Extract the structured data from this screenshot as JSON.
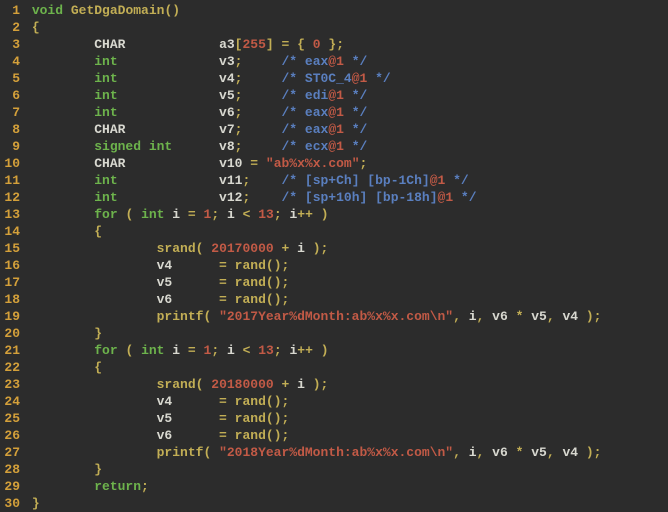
{
  "lines": [
    {
      "n": "1",
      "indent": " ",
      "tokens": [
        [
          "kw",
          "void"
        ],
        [
          "plain",
          " "
        ],
        [
          "func",
          "GetDgaDomain"
        ],
        [
          "punct",
          "()"
        ]
      ]
    },
    {
      "n": "2",
      "indent": " ",
      "tokens": [
        [
          "punct",
          "{"
        ]
      ]
    },
    {
      "n": "3",
      "indent": "         ",
      "tokens": [
        [
          "type",
          "CHAR"
        ],
        [
          "plain",
          "            "
        ],
        [
          "ident",
          "a3"
        ],
        [
          "punct",
          "["
        ],
        [
          "num",
          "255"
        ],
        [
          "punct",
          "]"
        ],
        [
          "plain",
          " "
        ],
        [
          "punct",
          "="
        ],
        [
          "plain",
          " "
        ],
        [
          "punct",
          "{"
        ],
        [
          "plain",
          " "
        ],
        [
          "num",
          "0"
        ],
        [
          "plain",
          " "
        ],
        [
          "punct",
          "};"
        ]
      ]
    },
    {
      "n": "4",
      "indent": "         ",
      "tokens": [
        [
          "kw",
          "int"
        ],
        [
          "plain",
          "             "
        ],
        [
          "ident",
          "v3"
        ],
        [
          "punct",
          ";"
        ],
        [
          "plain",
          "     "
        ],
        [
          "cmt",
          "/* eax"
        ],
        [
          "at",
          "@1"
        ],
        [
          "cmt",
          " */"
        ]
      ]
    },
    {
      "n": "5",
      "indent": "         ",
      "tokens": [
        [
          "kw",
          "int"
        ],
        [
          "plain",
          "             "
        ],
        [
          "ident",
          "v4"
        ],
        [
          "punct",
          ";"
        ],
        [
          "plain",
          "     "
        ],
        [
          "cmt",
          "/* ST0C_4"
        ],
        [
          "at",
          "@1"
        ],
        [
          "cmt",
          " */"
        ]
      ]
    },
    {
      "n": "6",
      "indent": "         ",
      "tokens": [
        [
          "kw",
          "int"
        ],
        [
          "plain",
          "             "
        ],
        [
          "ident",
          "v5"
        ],
        [
          "punct",
          ";"
        ],
        [
          "plain",
          "     "
        ],
        [
          "cmt",
          "/* edi"
        ],
        [
          "at",
          "@1"
        ],
        [
          "cmt",
          " */"
        ]
      ]
    },
    {
      "n": "7",
      "indent": "         ",
      "tokens": [
        [
          "kw",
          "int"
        ],
        [
          "plain",
          "             "
        ],
        [
          "ident",
          "v6"
        ],
        [
          "punct",
          ";"
        ],
        [
          "plain",
          "     "
        ],
        [
          "cmt",
          "/* eax"
        ],
        [
          "at",
          "@1"
        ],
        [
          "cmt",
          " */"
        ]
      ]
    },
    {
      "n": "8",
      "indent": "         ",
      "tokens": [
        [
          "type",
          "CHAR"
        ],
        [
          "plain",
          "            "
        ],
        [
          "ident",
          "v7"
        ],
        [
          "punct",
          ";"
        ],
        [
          "plain",
          "     "
        ],
        [
          "cmt",
          "/* eax"
        ],
        [
          "at",
          "@1"
        ],
        [
          "cmt",
          " */"
        ]
      ]
    },
    {
      "n": "9",
      "indent": "         ",
      "tokens": [
        [
          "kw",
          "signed int"
        ],
        [
          "plain",
          "      "
        ],
        [
          "ident",
          "v8"
        ],
        [
          "punct",
          ";"
        ],
        [
          "plain",
          "     "
        ],
        [
          "cmt",
          "/* ecx"
        ],
        [
          "at",
          "@1"
        ],
        [
          "cmt",
          " */"
        ]
      ]
    },
    {
      "n": "10",
      "indent": "         ",
      "tokens": [
        [
          "type",
          "CHAR"
        ],
        [
          "plain",
          "            "
        ],
        [
          "ident",
          "v10"
        ],
        [
          "plain",
          " "
        ],
        [
          "punct",
          "="
        ],
        [
          "plain",
          " "
        ],
        [
          "str",
          "\"ab%x%x.com\""
        ],
        [
          "punct",
          ";"
        ]
      ]
    },
    {
      "n": "11",
      "indent": "         ",
      "tokens": [
        [
          "kw",
          "int"
        ],
        [
          "plain",
          "             "
        ],
        [
          "ident",
          "v11"
        ],
        [
          "punct",
          ";"
        ],
        [
          "plain",
          "    "
        ],
        [
          "cmt",
          "/* [sp+Ch] [bp-1Ch]"
        ],
        [
          "at",
          "@1"
        ],
        [
          "cmt",
          " */"
        ]
      ]
    },
    {
      "n": "12",
      "indent": "         ",
      "tokens": [
        [
          "kw",
          "int"
        ],
        [
          "plain",
          "             "
        ],
        [
          "ident",
          "v12"
        ],
        [
          "punct",
          ";"
        ],
        [
          "plain",
          "    "
        ],
        [
          "cmt",
          "/* [sp+10h] [bp-18h]"
        ],
        [
          "at",
          "@1"
        ],
        [
          "cmt",
          " */"
        ]
      ]
    },
    {
      "n": "13",
      "indent": "         ",
      "tokens": [
        [
          "kw",
          "for"
        ],
        [
          "plain",
          " "
        ],
        [
          "punct",
          "("
        ],
        [
          "plain",
          " "
        ],
        [
          "kw",
          "int"
        ],
        [
          "plain",
          " "
        ],
        [
          "ident",
          "i"
        ],
        [
          "plain",
          " "
        ],
        [
          "punct",
          "="
        ],
        [
          "plain",
          " "
        ],
        [
          "num",
          "1"
        ],
        [
          "punct",
          ";"
        ],
        [
          "plain",
          " "
        ],
        [
          "ident",
          "i"
        ],
        [
          "plain",
          " "
        ],
        [
          "punct",
          "<"
        ],
        [
          "plain",
          " "
        ],
        [
          "num",
          "13"
        ],
        [
          "punct",
          ";"
        ],
        [
          "plain",
          " "
        ],
        [
          "ident",
          "i"
        ],
        [
          "punct",
          "++"
        ],
        [
          "plain",
          " "
        ],
        [
          "punct",
          ")"
        ]
      ]
    },
    {
      "n": "14",
      "indent": "         ",
      "tokens": [
        [
          "punct",
          "{"
        ]
      ]
    },
    {
      "n": "15",
      "indent": "                 ",
      "tokens": [
        [
          "func",
          "srand"
        ],
        [
          "punct",
          "("
        ],
        [
          "plain",
          " "
        ],
        [
          "num",
          "20170000"
        ],
        [
          "plain",
          " "
        ],
        [
          "punct",
          "+"
        ],
        [
          "plain",
          " "
        ],
        [
          "ident",
          "i"
        ],
        [
          "plain",
          " "
        ],
        [
          "punct",
          ");"
        ]
      ]
    },
    {
      "n": "16",
      "indent": "                 ",
      "tokens": [
        [
          "ident",
          "v4"
        ],
        [
          "plain",
          "      "
        ],
        [
          "punct",
          "="
        ],
        [
          "plain",
          " "
        ],
        [
          "func",
          "rand"
        ],
        [
          "punct",
          "();"
        ]
      ]
    },
    {
      "n": "17",
      "indent": "                 ",
      "tokens": [
        [
          "ident",
          "v5"
        ],
        [
          "plain",
          "      "
        ],
        [
          "punct",
          "="
        ],
        [
          "plain",
          " "
        ],
        [
          "func",
          "rand"
        ],
        [
          "punct",
          "();"
        ]
      ]
    },
    {
      "n": "18",
      "indent": "                 ",
      "tokens": [
        [
          "ident",
          "v6"
        ],
        [
          "plain",
          "      "
        ],
        [
          "punct",
          "="
        ],
        [
          "plain",
          " "
        ],
        [
          "func",
          "rand"
        ],
        [
          "punct",
          "();"
        ]
      ]
    },
    {
      "n": "19",
      "indent": "                 ",
      "tokens": [
        [
          "func",
          "printf"
        ],
        [
          "punct",
          "("
        ],
        [
          "plain",
          " "
        ],
        [
          "str",
          "\"2017Year%dMonth:ab%x%x.com\\n\""
        ],
        [
          "punct",
          ","
        ],
        [
          "plain",
          " "
        ],
        [
          "ident",
          "i"
        ],
        [
          "punct",
          ","
        ],
        [
          "plain",
          " "
        ],
        [
          "ident",
          "v6"
        ],
        [
          "plain",
          " "
        ],
        [
          "punct",
          "*"
        ],
        [
          "plain",
          " "
        ],
        [
          "ident",
          "v5"
        ],
        [
          "punct",
          ","
        ],
        [
          "plain",
          " "
        ],
        [
          "ident",
          "v4"
        ],
        [
          "plain",
          " "
        ],
        [
          "punct",
          ");"
        ]
      ]
    },
    {
      "n": "20",
      "indent": "         ",
      "tokens": [
        [
          "punct",
          "}"
        ]
      ]
    },
    {
      "n": "21",
      "indent": "         ",
      "tokens": [
        [
          "kw",
          "for"
        ],
        [
          "plain",
          " "
        ],
        [
          "punct",
          "("
        ],
        [
          "plain",
          " "
        ],
        [
          "kw",
          "int"
        ],
        [
          "plain",
          " "
        ],
        [
          "ident",
          "i"
        ],
        [
          "plain",
          " "
        ],
        [
          "punct",
          "="
        ],
        [
          "plain",
          " "
        ],
        [
          "num",
          "1"
        ],
        [
          "punct",
          ";"
        ],
        [
          "plain",
          " "
        ],
        [
          "ident",
          "i"
        ],
        [
          "plain",
          " "
        ],
        [
          "punct",
          "<"
        ],
        [
          "plain",
          " "
        ],
        [
          "num",
          "13"
        ],
        [
          "punct",
          ";"
        ],
        [
          "plain",
          " "
        ],
        [
          "ident",
          "i"
        ],
        [
          "punct",
          "++"
        ],
        [
          "plain",
          " "
        ],
        [
          "punct",
          ")"
        ]
      ]
    },
    {
      "n": "22",
      "indent": "         ",
      "tokens": [
        [
          "punct",
          "{"
        ]
      ]
    },
    {
      "n": "23",
      "indent": "                 ",
      "tokens": [
        [
          "func",
          "srand"
        ],
        [
          "punct",
          "("
        ],
        [
          "plain",
          " "
        ],
        [
          "num",
          "20180000"
        ],
        [
          "plain",
          " "
        ],
        [
          "punct",
          "+"
        ],
        [
          "plain",
          " "
        ],
        [
          "ident",
          "i"
        ],
        [
          "plain",
          " "
        ],
        [
          "punct",
          ");"
        ]
      ]
    },
    {
      "n": "24",
      "indent": "                 ",
      "tokens": [
        [
          "ident",
          "v4"
        ],
        [
          "plain",
          "      "
        ],
        [
          "punct",
          "="
        ],
        [
          "plain",
          " "
        ],
        [
          "func",
          "rand"
        ],
        [
          "punct",
          "();"
        ]
      ]
    },
    {
      "n": "25",
      "indent": "                 ",
      "tokens": [
        [
          "ident",
          "v5"
        ],
        [
          "plain",
          "      "
        ],
        [
          "punct",
          "="
        ],
        [
          "plain",
          " "
        ],
        [
          "func",
          "rand"
        ],
        [
          "punct",
          "();"
        ]
      ]
    },
    {
      "n": "26",
      "indent": "                 ",
      "tokens": [
        [
          "ident",
          "v6"
        ],
        [
          "plain",
          "      "
        ],
        [
          "punct",
          "="
        ],
        [
          "plain",
          " "
        ],
        [
          "func",
          "rand"
        ],
        [
          "punct",
          "();"
        ]
      ]
    },
    {
      "n": "27",
      "indent": "                 ",
      "tokens": [
        [
          "func",
          "printf"
        ],
        [
          "punct",
          "("
        ],
        [
          "plain",
          " "
        ],
        [
          "str",
          "\"2018Year%dMonth:ab%x%x.com\\n\""
        ],
        [
          "punct",
          ","
        ],
        [
          "plain",
          " "
        ],
        [
          "ident",
          "i"
        ],
        [
          "punct",
          ","
        ],
        [
          "plain",
          " "
        ],
        [
          "ident",
          "v6"
        ],
        [
          "plain",
          " "
        ],
        [
          "punct",
          "*"
        ],
        [
          "plain",
          " "
        ],
        [
          "ident",
          "v5"
        ],
        [
          "punct",
          ","
        ],
        [
          "plain",
          " "
        ],
        [
          "ident",
          "v4"
        ],
        [
          "plain",
          " "
        ],
        [
          "punct",
          ");"
        ]
      ]
    },
    {
      "n": "28",
      "indent": "         ",
      "tokens": [
        [
          "punct",
          "}"
        ]
      ]
    },
    {
      "n": "29",
      "indent": "         ",
      "tokens": [
        [
          "kw",
          "return"
        ],
        [
          "punct",
          ";"
        ]
      ]
    },
    {
      "n": "30",
      "indent": " ",
      "tokens": [
        [
          "punct",
          "}"
        ]
      ]
    }
  ]
}
